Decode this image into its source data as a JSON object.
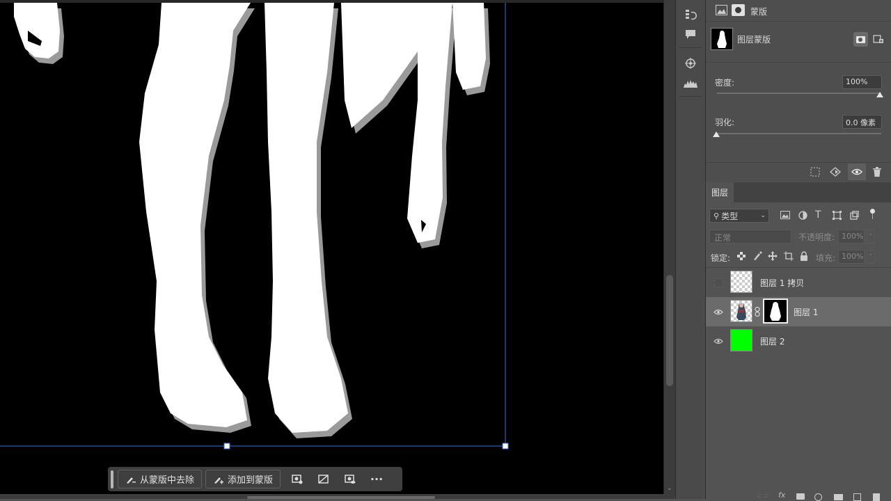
{
  "properties": {
    "header_title": "蒙版",
    "mask_type_label": "图层蒙版",
    "density_label": "密度:",
    "density_value": "100%",
    "feather_label": "羽化:",
    "feather_value": "0.0 像素"
  },
  "layers": {
    "tab_label": "图层",
    "filter_kind": "类型",
    "blend_mode": "正常",
    "opacity_label": "不透明度:",
    "opacity_value": "100%",
    "lock_label": "锁定:",
    "fill_label": "填充:",
    "fill_value": "100%",
    "items": [
      {
        "name": "图层 1 拷贝",
        "visible": false,
        "thumb": "transparent"
      },
      {
        "name": "图层 1",
        "visible": true,
        "thumb": "character",
        "mask": "silhouette",
        "selected": true
      },
      {
        "name": "图层 2",
        "visible": true,
        "thumb": "green-fill"
      }
    ]
  },
  "taskbar": {
    "subtract_label": "从蒙版中去除",
    "add_label": "添加到蒙版"
  },
  "colors": {
    "accent_green": "#00ff00",
    "canvas_bg": "#000000",
    "selection_line": "#3b6fd4",
    "panel_bg": "#535353"
  }
}
